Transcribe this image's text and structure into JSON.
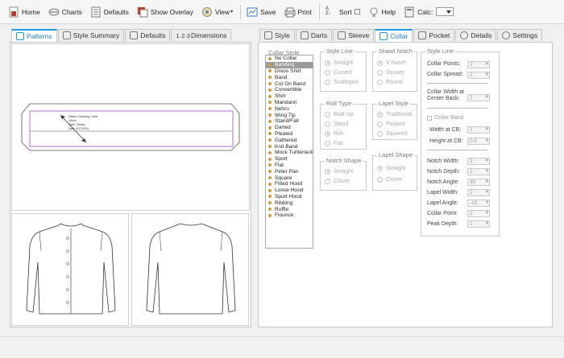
{
  "toolbar": {
    "home": "Home",
    "charts": "Charts",
    "defaults": "Defaults",
    "show_overlay": "Show Overlay",
    "view": "View",
    "save": "Save",
    "print": "Print",
    "sort": "Sort",
    "help": "Help",
    "calc": "Calc:"
  },
  "left_tabs": [
    "Patterns",
    "Style Summary",
    "Defaults",
    "Dimensions"
  ],
  "left_tab_dim_prefix": "1·2·3",
  "pattern_label": {
    "line1": "Pattern:  Banding Collar",
    "line2": "Client:",
    "line3": "Style:  Classic",
    "line4": "Date:  6/17/2024"
  },
  "right_tabs": [
    "Style",
    "Darts",
    "Sleeve",
    "Collar",
    "Pocket",
    "Details",
    "Settings"
  ],
  "collar_style": {
    "title": "Collar Style",
    "items": [
      "No Collar",
      "Banding",
      "Dress Shirt",
      "Band",
      "Cut On Band",
      "Convertible",
      "Shirt",
      "Mandarin",
      "Nehru",
      "Wing Tip",
      "Stand/Fall",
      "Darted",
      "Pleated",
      "Gathered",
      "Knit Band",
      "Mock Turtleneck",
      "Sport",
      "Flat",
      "Peter Pan",
      "Square",
      "Fitted Hood",
      "Loose Hood",
      "Sport Hood",
      "Ribbing",
      "Ruffle",
      "Flounce"
    ],
    "selected": "Banding"
  },
  "style_line": {
    "title": "Style Line",
    "options": [
      "Straight",
      "Curved",
      "Scalloped"
    ]
  },
  "shawl_notch": {
    "title": "Shawl Notch",
    "options": [
      "V-Notch",
      "Square",
      "Round"
    ]
  },
  "roll_type": {
    "title": "Roll Type",
    "options": [
      "Built Up",
      "Stand",
      "Roll",
      "Flat"
    ]
  },
  "lapel_style": {
    "title": "Lapel Style",
    "options": [
      "Traditional",
      "Peaked",
      "Squared"
    ]
  },
  "notch_shape": {
    "title": "Notch Shape",
    "options": [
      "Straight",
      "Clover"
    ]
  },
  "lapel_shape": {
    "title": "Lapel Shape",
    "options": [
      "Straight",
      "Clover"
    ]
  },
  "style_line_panel": {
    "title": "Style Line",
    "collar_points_label": "Collar Points:",
    "collar_points_value": "2",
    "collar_spread_label": "Collar Spread:",
    "collar_spread_value": "2",
    "collar_width_label_1": "Collar Width at",
    "collar_width_label_2": "Center Back:",
    "collar_width_value": "2",
    "collar_band_label": "Collar Band",
    "width_cb_label": "Width at CB:",
    "width_cb_value": "1",
    "height_cb_label": "Height at CB:",
    "height_cb_value": "0.5",
    "notch_width_label": "Notch Width:",
    "notch_width_value": "2",
    "notch_depth_label": "Notch Depth:",
    "notch_depth_value": "2",
    "notch_angle_label": "Notch Angle:",
    "notch_angle_value": "90",
    "lapel_width_label": "Lapel Width:",
    "lapel_width_value": "2",
    "lapel_angle_label": "Lapel Angle:",
    "lapel_angle_value": "-15",
    "collar_point_label": "Collar Point:",
    "collar_point_value": "2",
    "peak_depth_label": "Peak Depth:",
    "peak_depth_value": "1"
  }
}
